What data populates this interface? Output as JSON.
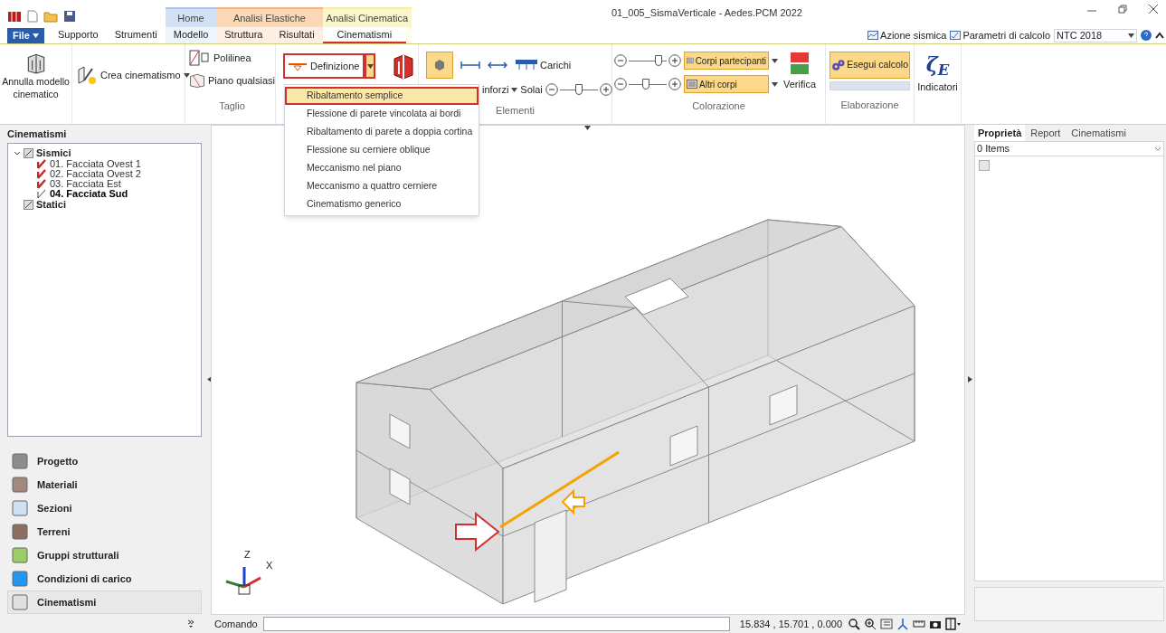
{
  "window": {
    "title": "01_005_SismaVerticale - Aedes.PCM 2022"
  },
  "file_menu": {
    "label": "File"
  },
  "tab_groups": [
    {
      "tabs": [
        {
          "label": "Supporto",
          "selected": false
        },
        {
          "label": "Strumenti",
          "selected": false
        }
      ]
    },
    {
      "label": "Home",
      "color": "#a9c6ee",
      "tabs": [
        {
          "label": "Modello",
          "selected": false
        }
      ]
    },
    {
      "label": "Analisi Elastiche",
      "color": "#f7b575",
      "tabs": [
        {
          "label": "Struttura",
          "selected": false
        },
        {
          "label": "Risultati",
          "selected": false
        }
      ]
    },
    {
      "label": "Analisi Cinematica",
      "color": "#f5ef9c",
      "tabs": [
        {
          "label": "Cinematismi",
          "selected": true
        }
      ]
    }
  ],
  "top_right": {
    "azione": "Azione sismica",
    "parametri": "Parametri di calcolo",
    "norm": "NTC 2018"
  },
  "ribbon": {
    "annulla": "Annulla modello cinematico",
    "crea": "Crea cinematismo",
    "taglio": {
      "title": "Taglio",
      "polilinea": "Polilinea",
      "piano": "Piano qualsiasi"
    },
    "definizione": {
      "label": "Definizione",
      "expanded": true
    },
    "elementi": {
      "title": "Elementi",
      "rinforzi": "inforzi",
      "solai": "Solai",
      "carichi": "Carichi",
      "level": 0.5
    },
    "colorazione": {
      "title": "Colorazione",
      "rows": [
        {
          "level": 0.85,
          "field": "Corpi partecipanti"
        },
        {
          "level": 0.45,
          "field": "Altri corpi"
        }
      ],
      "verifica": "Verifica"
    },
    "elaborazione": {
      "title": "Elaborazione",
      "esegui": "Esegui calcolo",
      "level": 0
    },
    "indicatori": {
      "symbol": "ζ$_{E}$",
      "label": "Indicatori"
    }
  },
  "definizione_menu": [
    {
      "label": "Ribaltamento semplice",
      "selected": true
    },
    {
      "label": "Flessione di parete vincolata ai bordi",
      "selected": false
    },
    {
      "label": "Ribaltamento di parete a doppia cortina",
      "selected": false
    },
    {
      "label": "Flessione su cerniere oblique",
      "selected": false
    },
    {
      "label": "Meccanismo nel piano",
      "selected": false
    },
    {
      "label": "Meccanismo a quattro cerniere",
      "selected": false
    },
    {
      "label": "Cinematismo generico",
      "selected": false
    }
  ],
  "left_panel": {
    "title": "Cinematismi",
    "tree": [
      {
        "label": "Sismici",
        "expanded": true,
        "children": [
          {
            "label": "01. Facciata Ovest 1",
            "complete": true,
            "selected": false
          },
          {
            "label": "02. Facciata Ovest 2",
            "complete": true,
            "selected": false
          },
          {
            "label": "03. Facciata Est",
            "complete": true,
            "selected": false
          },
          {
            "label": "04. Facciata Sud",
            "complete": false,
            "selected": true
          }
        ]
      },
      {
        "label": "Statici"
      }
    ]
  },
  "nav": [
    {
      "label": "Progetto",
      "selected": false
    },
    {
      "label": "Materiali",
      "selected": false
    },
    {
      "label": "Sezioni",
      "selected": false
    },
    {
      "label": "Terreni",
      "selected": false
    },
    {
      "label": "Gruppi strutturali",
      "selected": false
    },
    {
      "label": "Condizioni di carico",
      "selected": false
    },
    {
      "label": "Cinematismi",
      "selected": true
    }
  ],
  "viewport": {
    "axis_z": "Z",
    "axis_x": "X"
  },
  "right_panel": {
    "tabs": [
      {
        "label": "Proprietà",
        "selected": true
      },
      {
        "label": "Report",
        "selected": false
      },
      {
        "label": "Cinematismi",
        "selected": false
      }
    ],
    "select": "0 Items"
  },
  "status_bar": {
    "command_label": "Comando",
    "coords": "15.834 , 15.701 , 0.000"
  }
}
